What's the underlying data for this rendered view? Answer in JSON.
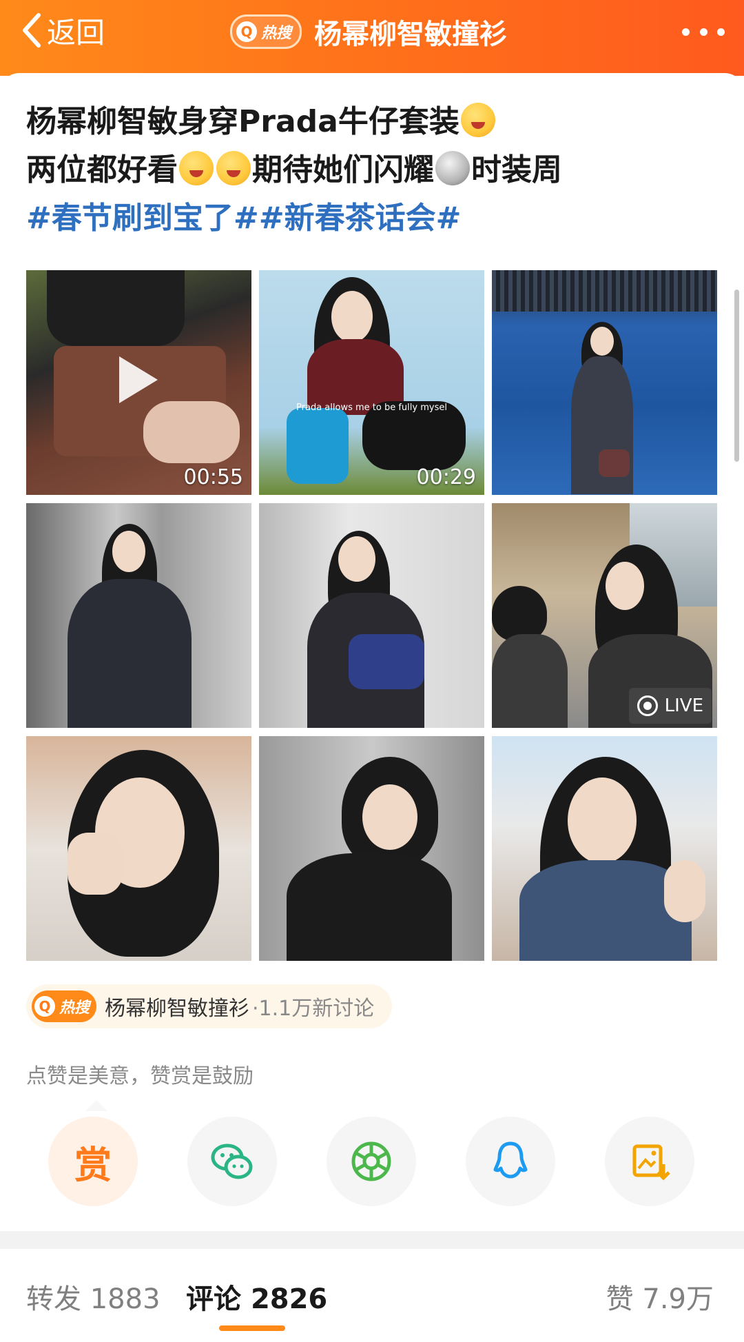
{
  "header": {
    "back_label": "返回",
    "hot_badge_label": "热搜",
    "title": "杨幂柳智敏撞衫",
    "accent": "#ff7a1a"
  },
  "post": {
    "line1": "杨幂柳智敏身穿Prada牛仔套装",
    "line2_a": "两位都好看",
    "line2_b": "期待她们闪耀",
    "line2_c": "时装周",
    "tags": "#春节刷到宝了##新春茶话会#",
    "tag_color": "#2f6fc0"
  },
  "media": [
    {
      "kind": "video",
      "duration": "00:55"
    },
    {
      "kind": "video",
      "duration": "00:29",
      "caption": "Prada allows me to be fully mysel"
    },
    {
      "kind": "image"
    },
    {
      "kind": "image"
    },
    {
      "kind": "image"
    },
    {
      "kind": "live",
      "badge": "LIVE"
    },
    {
      "kind": "image"
    },
    {
      "kind": "image"
    },
    {
      "kind": "image"
    }
  ],
  "hot_chip": {
    "badge": "热搜",
    "topic": "杨幂柳智敏撞衫",
    "count": "·1.1万新讨论"
  },
  "reward_note": "点赞是美意，赞赏是鼓励",
  "share": {
    "reward_label": "赏",
    "icons": [
      "wechat-icon",
      "moments-icon",
      "qq-icon",
      "save-image-icon"
    ]
  },
  "stats": {
    "repost_label": "转发",
    "repost_count": "1883",
    "comment_label": "评论",
    "comment_count": "2826",
    "like_label": "赞",
    "like_count": "7.9万"
  }
}
